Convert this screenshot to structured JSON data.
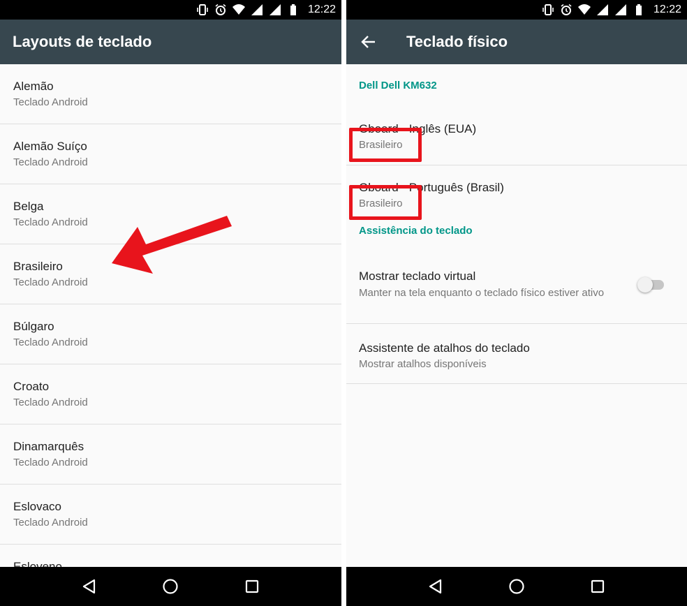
{
  "status_bar": {
    "time": "12:22",
    "icons": [
      "vibrate-icon",
      "alarm-icon",
      "wifi-icon",
      "cell-signal-icon",
      "cell-signal-icon",
      "battery-icon"
    ]
  },
  "left_screen": {
    "title": "Layouts de teclado",
    "items": [
      {
        "label": "Alemão",
        "sub": "Teclado Android"
      },
      {
        "label": "Alemão Suíço",
        "sub": "Teclado Android"
      },
      {
        "label": "Belga",
        "sub": "Teclado Android"
      },
      {
        "label": "Brasileiro",
        "sub": "Teclado Android"
      },
      {
        "label": "Búlgaro",
        "sub": "Teclado Android"
      },
      {
        "label": "Croato",
        "sub": "Teclado Android"
      },
      {
        "label": "Dinamarquês",
        "sub": "Teclado Android"
      },
      {
        "label": "Eslovaco",
        "sub": "Teclado Android"
      },
      {
        "label": "Esloveno",
        "sub": ""
      }
    ],
    "annotation": {
      "type": "arrow",
      "color": "#e8141c",
      "points_to": "Brasileiro"
    }
  },
  "right_screen": {
    "title": "Teclado físico",
    "device_header": "Dell Dell KM632",
    "keyboards": [
      {
        "label": "Gboard - Inglês (EUA)",
        "sub": "Brasileiro"
      },
      {
        "label": "Gboard - Português (Brasil)",
        "sub": "Brasileiro"
      }
    ],
    "assist_header": "Assistência do teclado",
    "show_virtual": {
      "label": "Mostrar teclado virtual",
      "sub": "Manter na tela enquanto o teclado físico estiver ativo",
      "enabled": false
    },
    "shortcuts": {
      "label": "Assistente de atalhos do teclado",
      "sub": "Mostrar atalhos disponíveis"
    },
    "highlight_color": "#e8141c"
  },
  "nav_bar": {
    "icons": [
      "back-icon",
      "home-icon",
      "recents-icon"
    ]
  },
  "colors": {
    "app_bar": "#37474f",
    "section_header": "#009688",
    "background": "#fafafa"
  }
}
